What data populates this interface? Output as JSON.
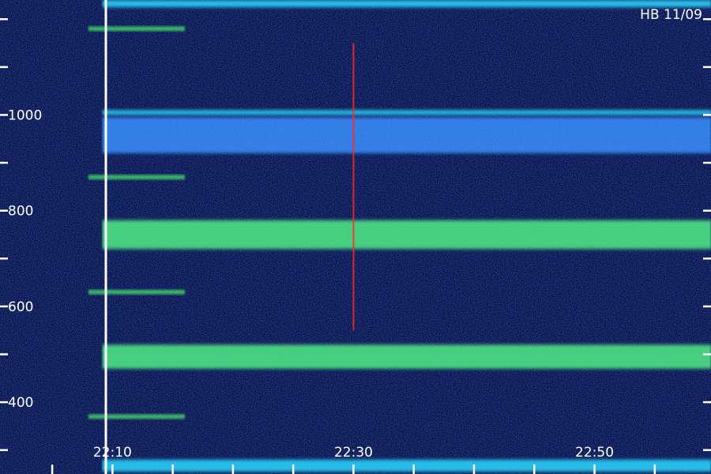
{
  "header": {
    "stamp": "HB 11/09"
  },
  "chart_data": {
    "type": "heatmap",
    "title": "",
    "xlabel": "",
    "ylabel": "",
    "x_tick_labels": [
      "22:10",
      "22:30",
      "22:50"
    ],
    "y_tick_labels": [
      "400",
      "600",
      "800",
      "1000"
    ],
    "x_range": [
      "22:00:40",
      "22:59:40"
    ],
    "y_range": [
      250,
      1240
    ],
    "x_tick_minor_step_min": 5,
    "y_tick_minor_step": 100,
    "colormap": [
      "#000000",
      "#000a60",
      "#0a2aff",
      "#2f8cff",
      "#1ee6ff",
      "#4cff6a",
      "#ffd21f",
      "#ff2a1f"
    ],
    "bands": [
      {
        "y_from": 720,
        "y_to": 780,
        "intensity": 0.72
      },
      {
        "y_from": 1000,
        "y_to": 1010,
        "intensity": 0.62
      },
      {
        "y_from": 920,
        "y_to": 995,
        "intensity": 0.42
      },
      {
        "y_from": 470,
        "y_to": 520,
        "intensity": 0.66
      },
      {
        "y_from": 255,
        "y_to": 280,
        "intensity": 0.62
      },
      {
        "y_from": 1225,
        "y_to": 1240,
        "intensity": 0.6
      }
    ],
    "bursts": [
      {
        "y": 1180,
        "t_from": "22:08",
        "t_to": "22:16",
        "intensity": 0.75
      },
      {
        "y": 870,
        "t_from": "22:08",
        "t_to": "22:16",
        "intensity": 0.75
      },
      {
        "y": 630,
        "t_from": "22:08",
        "t_to": "22:16",
        "intensity": 0.75
      },
      {
        "y": 370,
        "t_from": "22:08",
        "t_to": "22:16",
        "intensity": 0.75
      }
    ],
    "event": {
      "time": "22:30",
      "y_from": 550,
      "y_to": 1150,
      "intensity": 1.0
    }
  }
}
